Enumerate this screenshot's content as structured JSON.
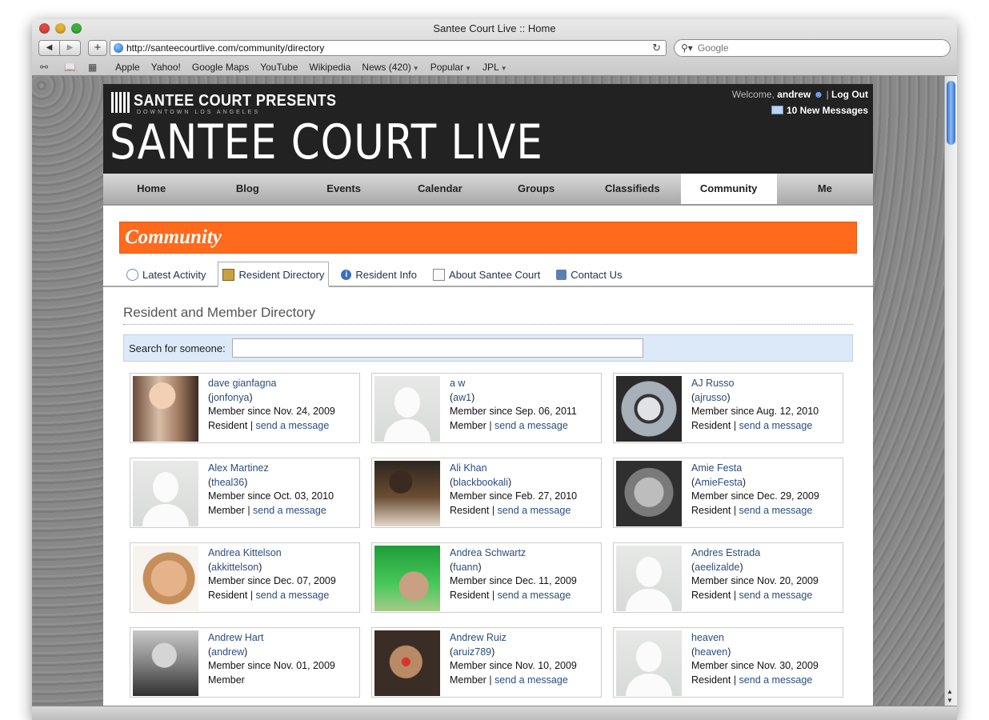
{
  "browser": {
    "window_title": "Santee Court Live :: Home",
    "url": "http://santeecourtlive.com/community/directory",
    "search_placeholder": "Google",
    "bookmarks": [
      "Apple",
      "Yahoo!",
      "Google Maps",
      "YouTube",
      "Wikipedia",
      "News (420)",
      "Popular",
      "JPL"
    ]
  },
  "header": {
    "presents": "SANTEE COURT PRESENTS",
    "tagline": "DOWNTOWN LOS ANGELES",
    "site_name": "SANTEE COURT LIVE",
    "welcome": "Welcome,",
    "username": "andrew",
    "logout": "Log Out",
    "messages": "10 New Messages"
  },
  "nav": {
    "items": [
      "Home",
      "Blog",
      "Events",
      "Calendar",
      "Groups",
      "Classifieds",
      "Community",
      "Me"
    ],
    "active": "Community"
  },
  "community": {
    "title": "Community",
    "tabs": [
      "Latest Activity",
      "Resident Directory",
      "Resident Info",
      "About Santee Court",
      "Contact Us"
    ],
    "active_tab": "Resident Directory"
  },
  "directory": {
    "title": "Resident and Member Directory",
    "search_label": "Search for someone:",
    "send_label": "send a message",
    "members": [
      {
        "name": "dave gianfagna",
        "username": "jonfonya",
        "since": "Member since Nov. 24, 2009",
        "role": "Resident",
        "can_message": true,
        "photo": "dave"
      },
      {
        "name": "a w",
        "username": "aw1",
        "since": "Member since Sep. 06, 2011",
        "role": "Member",
        "can_message": true,
        "photo": "generic"
      },
      {
        "name": "AJ Russo",
        "username": "ajrusso",
        "since": "Member since Aug. 12, 2010",
        "role": "Resident",
        "can_message": true,
        "photo": "aj"
      },
      {
        "name": "Alex Martinez",
        "username": "theal36",
        "since": "Member since Oct. 03, 2010",
        "role": "Member",
        "can_message": true,
        "photo": "generic"
      },
      {
        "name": "Ali Khan",
        "username": "blackbookali",
        "since": "Member since Feb. 27, 2010",
        "role": "Resident",
        "can_message": true,
        "photo": "ali"
      },
      {
        "name": "Amie Festa",
        "username": "AmieFesta",
        "since": "Member since Dec. 29, 2009",
        "role": "Resident",
        "can_message": true,
        "photo": "amie"
      },
      {
        "name": "Andrea Kittelson",
        "username": "akkittelson",
        "since": "Member since Dec. 07, 2009",
        "role": "Resident",
        "can_message": true,
        "photo": "andrea"
      },
      {
        "name": "Andrea Schwartz",
        "username": "fuann",
        "since": "Member since Dec. 11, 2009",
        "role": "Resident",
        "can_message": true,
        "photo": "schwartz"
      },
      {
        "name": "Andres Estrada",
        "username": "aeelizalde",
        "since": "Member since Nov. 20, 2009",
        "role": "Resident",
        "can_message": true,
        "photo": "generic"
      },
      {
        "name": "Andrew Hart",
        "username": "andrew",
        "since": "Member since Nov. 01, 2009",
        "role": "Member",
        "can_message": false,
        "photo": "hart"
      },
      {
        "name": "Andrew Ruiz",
        "username": "aruiz789",
        "since": "Member since Nov. 10, 2009",
        "role": "Member",
        "can_message": true,
        "photo": "ruiz"
      },
      {
        "name": "heaven",
        "username": "heaven",
        "since": "Member since Nov. 30, 2009",
        "role": "Resident",
        "can_message": true,
        "photo": "generic"
      }
    ]
  },
  "colors": {
    "accent_orange": "#ff6a1d",
    "header_bg": "#222222",
    "link_blue": "#2a4d7e",
    "search_bg": "#dce9f9"
  }
}
